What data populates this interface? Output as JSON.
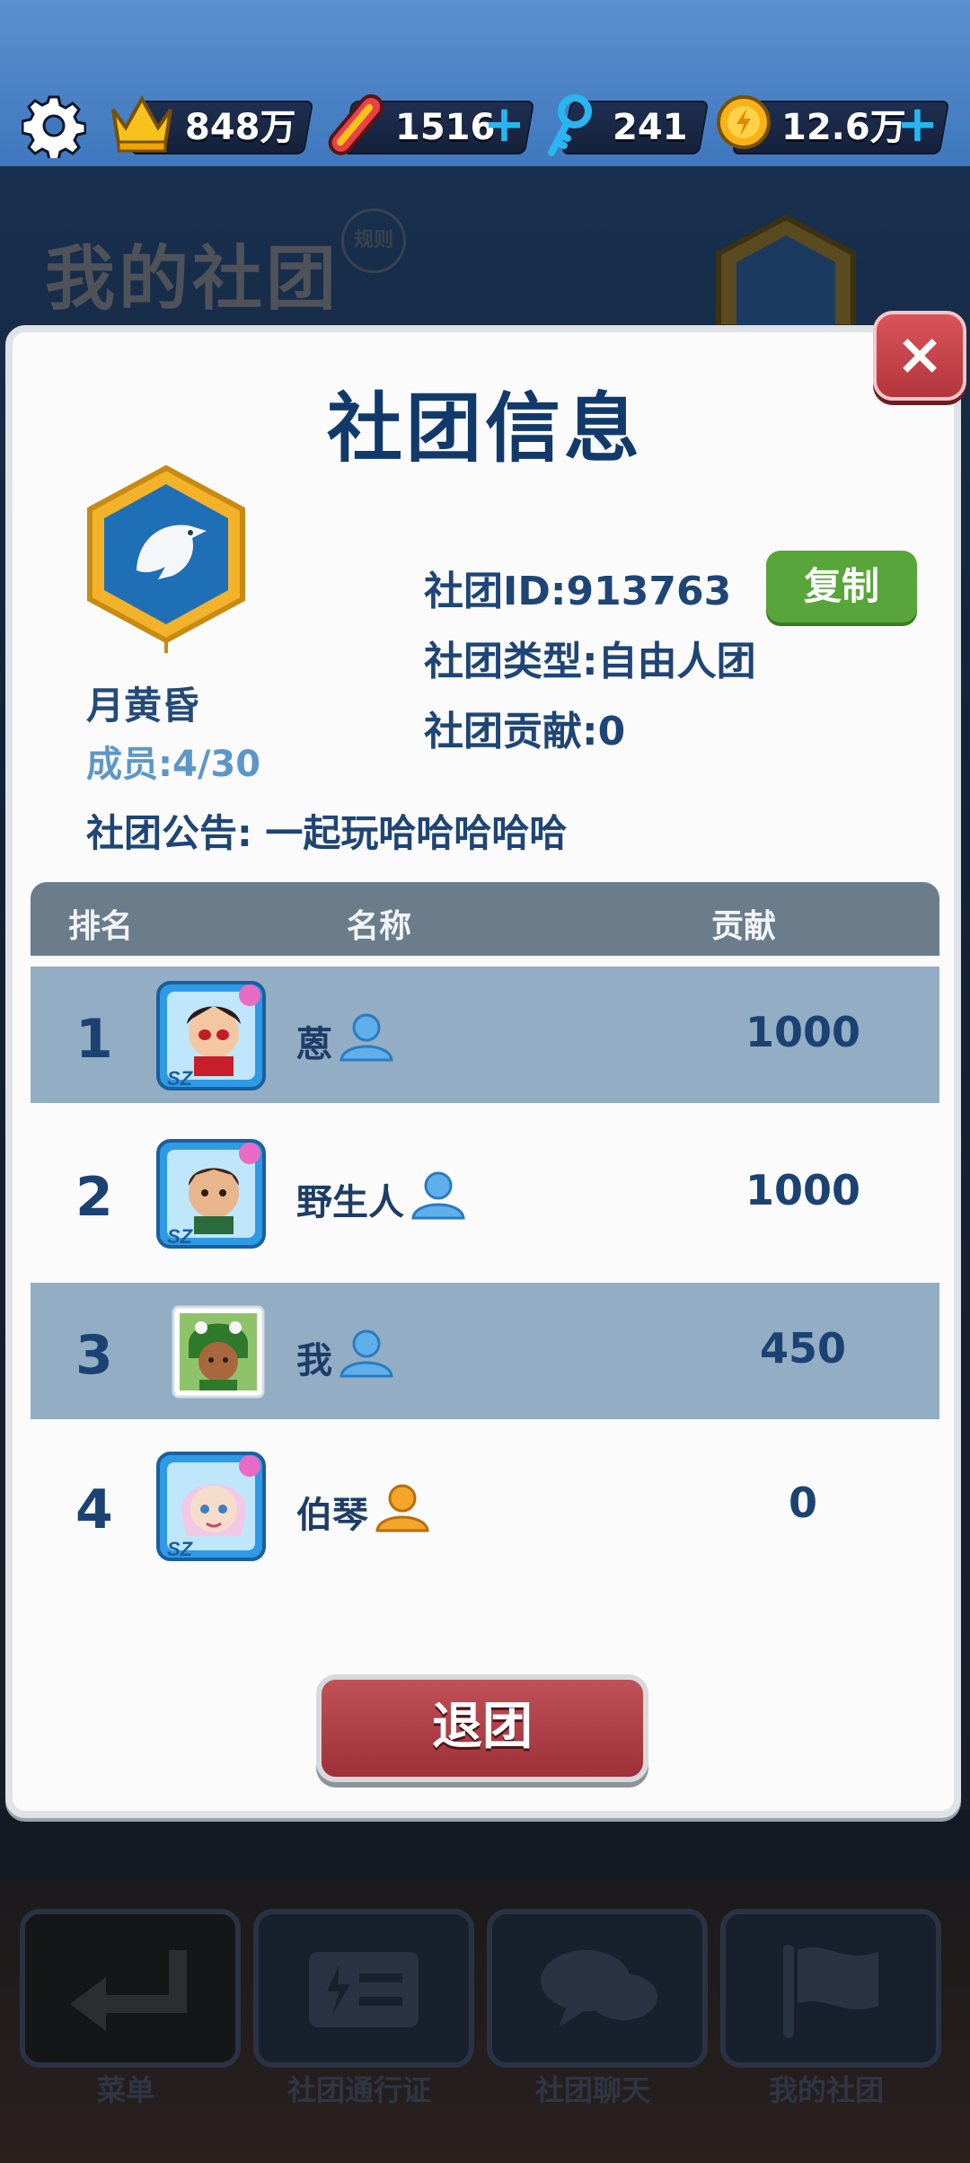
{
  "topbar": {
    "crowns": "848万",
    "boards": "1516",
    "keys": "241",
    "coins": "12.6万",
    "plus": "+"
  },
  "background": {
    "title": "我的社团",
    "rule_label": "规则",
    "nav": [
      {
        "label": "菜单",
        "icon": "back-arrow-icon"
      },
      {
        "label": "社团通行证",
        "icon": "pass-icon"
      },
      {
        "label": "社团聊天",
        "icon": "chat-icon"
      },
      {
        "label": "我的社团",
        "icon": "flag-icon"
      }
    ]
  },
  "modal": {
    "title": "社团信息",
    "close_label": "×",
    "club_name": "月黄昏",
    "members": "成员:4/30",
    "club_id": "社团ID:913763",
    "copy_label": "复制",
    "club_type": "社团类型:自由人团",
    "club_contribution": "社团贡献:0",
    "notice": "社团公告: 一起玩哈哈哈哈哈",
    "table": {
      "headers": [
        "排名",
        "名称",
        "贡献"
      ],
      "rows": [
        {
          "rank": "1",
          "name": "蒽",
          "contribution": "1000",
          "role": "member"
        },
        {
          "rank": "2",
          "name": "野生人",
          "contribution": "1000",
          "role": "member"
        },
        {
          "rank": "3",
          "name": "我",
          "contribution": "450",
          "role": "member"
        },
        {
          "rank": "4",
          "name": "伯琴",
          "contribution": "0",
          "role": "leader"
        }
      ]
    },
    "quit_label": "退团"
  },
  "colors": {
    "accent_blue": "#113a6b",
    "copy_green": "#58a63b",
    "quit_red": "#b3363d",
    "row_alt": "#93adc4"
  }
}
